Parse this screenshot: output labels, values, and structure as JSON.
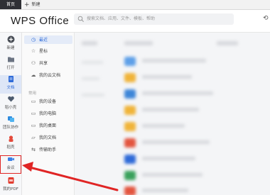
{
  "tabs": {
    "active": "首页",
    "new_tab": "新建"
  },
  "header": {
    "logo": "WPS Office",
    "search_placeholder": "搜索文档、应用、文件、模板、帮助"
  },
  "rail": [
    {
      "label": "新建",
      "icon": "plus-icon",
      "color": "#555555"
    },
    {
      "label": "打开",
      "icon": "folder-icon",
      "color": "#6a7382"
    },
    {
      "label": "文档",
      "icon": "document-icon",
      "color": "#2f6bd8",
      "selected": true
    },
    {
      "label": "稻小壳",
      "icon": "heart-icon",
      "color": "#4d5b6e"
    },
    {
      "label": "团队协作",
      "icon": "team-icon",
      "color": "#2e8bde"
    },
    {
      "label": "稻壳",
      "icon": "docer-icon",
      "color": "#e34a3c"
    },
    {
      "label": "会议",
      "icon": "meeting-icon",
      "color": "#3a7fe6",
      "highlighted": true
    },
    {
      "label": "我的PDF",
      "icon": "pdf-icon",
      "color": "#e23b2e"
    }
  ],
  "nav": {
    "items": [
      {
        "label": "最近",
        "icon": "clock-icon",
        "selected": true
      },
      {
        "label": "星标",
        "icon": "star-icon"
      },
      {
        "label": "共享",
        "icon": "share-icon"
      },
      {
        "label": "我的云文档",
        "icon": "cloud-icon"
      }
    ],
    "section": "常用",
    "section_items": [
      {
        "label": "我的设备",
        "icon": "device-icon"
      },
      {
        "label": "我的电脑",
        "icon": "computer-icon"
      },
      {
        "label": "我的桌面",
        "icon": "desktop-icon"
      },
      {
        "label": "我的文档",
        "icon": "folder-icon"
      },
      {
        "label": "传输助手",
        "icon": "transfer-icon"
      }
    ]
  },
  "colors": {
    "accent": "#2f6bd8",
    "arrow": "#e02525"
  }
}
